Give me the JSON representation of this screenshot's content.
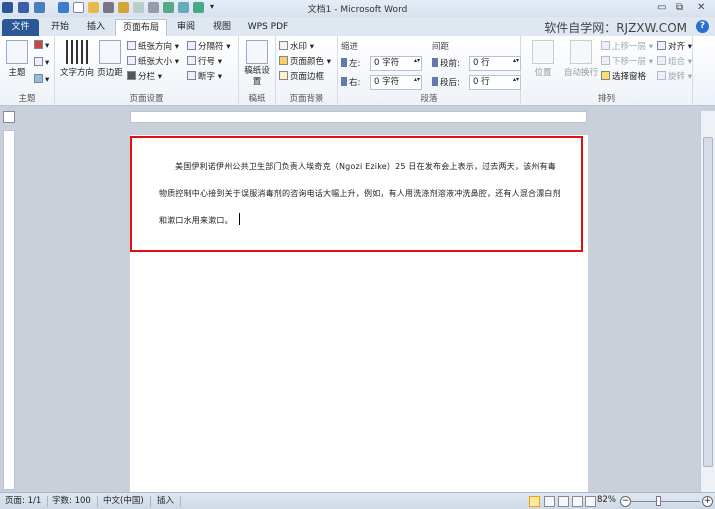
{
  "window": {
    "title": "文档1 - Microsoft Word",
    "minimize": "▭",
    "restore": "⧉",
    "close": "✕"
  },
  "tabs": [
    {
      "label": "文件"
    },
    {
      "label": "开始"
    },
    {
      "label": "插入"
    },
    {
      "label": "页面布局"
    },
    {
      "label": "审阅"
    },
    {
      "label": "视图"
    },
    {
      "label": "WPS PDF"
    }
  ],
  "brand": "软件自学网：RJZXW.COM",
  "help": "?",
  "ribbon": {
    "theme": {
      "label": "主题",
      "big": "主题"
    },
    "page_setup": {
      "label": "页面设置",
      "text_direction": "文字方向",
      "margins": "页边距",
      "orientation": "纸张方向 ▾",
      "size": "纸张大小 ▾",
      "columns": "分栏 ▾",
      "breaks": "分隔符 ▾",
      "line_numbers": "行号 ▾",
      "hyphenation": "断字 ▾"
    },
    "manuscript": {
      "label": "稿纸",
      "button": "稿纸设置"
    },
    "background": {
      "label": "页面背景",
      "watermark": "水印 ▾",
      "page_color": "页面颜色 ▾",
      "page_borders": "页面边框"
    },
    "paragraph": {
      "label": "段落",
      "indent": "缩进",
      "spacing": "间距",
      "left_label": "左:",
      "left_value": "0 字符",
      "right_label": "右:",
      "right_value": "0 字符",
      "before_label": "段前:",
      "before_value": "0 行",
      "after_label": "段后:",
      "after_value": "0 行"
    },
    "arrange": {
      "label": "排列",
      "position": "位置",
      "wrap": "自动换行",
      "bring_forward": "上移一层 ▾",
      "send_backward": "下移一层 ▾",
      "selection_pane": "选择窗格",
      "align": "对齐 ▾",
      "group": "组合 ▾",
      "rotate": "旋转 ▾"
    }
  },
  "document": {
    "text": "美国伊利诺伊州公共卫生部门负责人埃奇克（Ngozi Ezike）25 日在发布会上表示，过去两天，该州有毒物质控制中心接到关于误服消毒剂的咨询电话大幅上升，例如，有人用洗涤剂溶液冲洗鼻腔，还有人混合漂白剂和漱口水用来漱口。"
  },
  "status": {
    "page": "页面: 1/1",
    "words": "字数: 100",
    "language": "中文(中国)",
    "mode": "插入",
    "zoom": "82%",
    "zoom_out": "−",
    "zoom_in": "+",
    "zoom_percent": 82
  }
}
